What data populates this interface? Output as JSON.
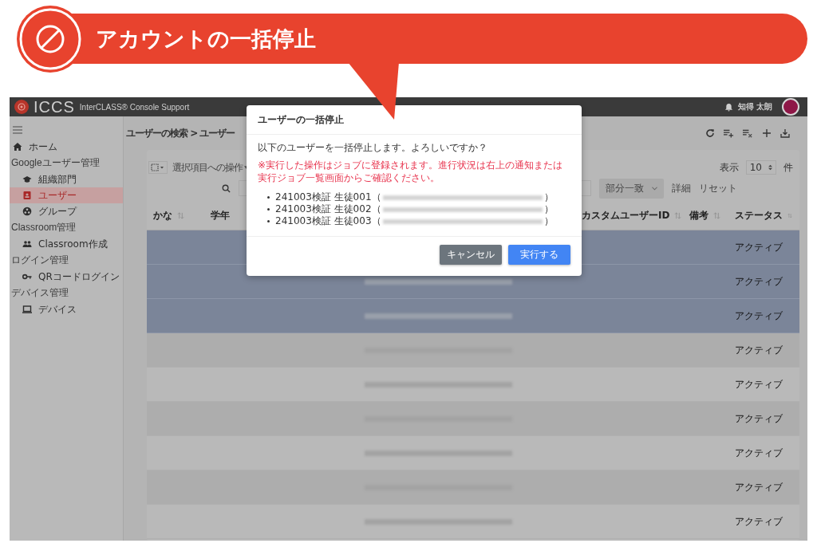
{
  "banner": {
    "title": "アカウントの一括停止"
  },
  "header": {
    "logo": "ICCS",
    "product": "InterCLASS® Console Support",
    "user": "知得 太朗"
  },
  "sidebar": {
    "items": [
      {
        "label": "ホーム",
        "selected": false
      },
      {
        "heading": "Googleユーザー管理",
        "children": [
          {
            "label": "組織部門",
            "selected": false
          },
          {
            "label": "ユーザー",
            "selected": true
          },
          {
            "label": "グループ",
            "selected": false
          }
        ]
      },
      {
        "heading": "Classroom管理",
        "children": [
          {
            "label": "Classroom作成",
            "selected": false
          }
        ]
      },
      {
        "heading": "ログイン管理",
        "children": [
          {
            "label": "QRコードログイン",
            "selected": false
          }
        ]
      },
      {
        "heading": "デバイス管理",
        "children": [
          {
            "label": "デバイス",
            "selected": false
          }
        ]
      }
    ]
  },
  "breadcrumb": "ユーザーの検索 > ユーザー",
  "toolbar": {
    "bulk_action": "選択項目への操作",
    "match_mode": "部分一致",
    "details": "詳細",
    "reset": "リセット",
    "page_size_prefix": "表示",
    "page_size": "10",
    "page_size_suffix": "件"
  },
  "table": {
    "columns": [
      {
        "label": "かな",
        "sortable": true
      },
      {
        "label": "学年",
        "sortable": false
      },
      {
        "label": "カスタムユーザーID",
        "sortable": true
      },
      {
        "label": "備考",
        "sortable": true
      },
      {
        "label": "ステータス",
        "sortable": true
      }
    ],
    "rows": [
      {
        "selected": true,
        "email_visible": false,
        "status": "アクティブ"
      },
      {
        "selected": true,
        "email_visible": true,
        "status": "アクティブ"
      },
      {
        "selected": true,
        "email_visible": true,
        "status": "アクティブ"
      },
      {
        "selected": false,
        "email_visible": true,
        "status": "アクティブ"
      },
      {
        "selected": false,
        "email_visible": true,
        "status": "アクティブ"
      },
      {
        "selected": false,
        "email_visible": true,
        "status": "アクティブ"
      },
      {
        "selected": false,
        "email_visible": true,
        "status": "アクティブ"
      },
      {
        "selected": false,
        "email_visible": true,
        "status": "アクティブ"
      },
      {
        "selected": false,
        "email_visible": true,
        "status": "アクティブ"
      }
    ]
  },
  "dialog": {
    "title": "ユーザーの一括停止",
    "message": "以下のユーザーを一括停止します。よろしいですか？",
    "warning": "※実行した操作はジョブに登録されます。進行状況は右上の通知または実行ジョブ一覧画面からご確認ください。",
    "users": [
      {
        "name": "241003検証 生徒001（",
        "close": "）"
      },
      {
        "name": "241003検証 生徒002（",
        "close": "）"
      },
      {
        "name": "241003検証 生徒003（",
        "close": "）"
      }
    ],
    "buttons": [
      {
        "kind": "cancel",
        "label": "キャンセル"
      },
      {
        "kind": "confirm",
        "label": "実行する"
      }
    ]
  }
}
